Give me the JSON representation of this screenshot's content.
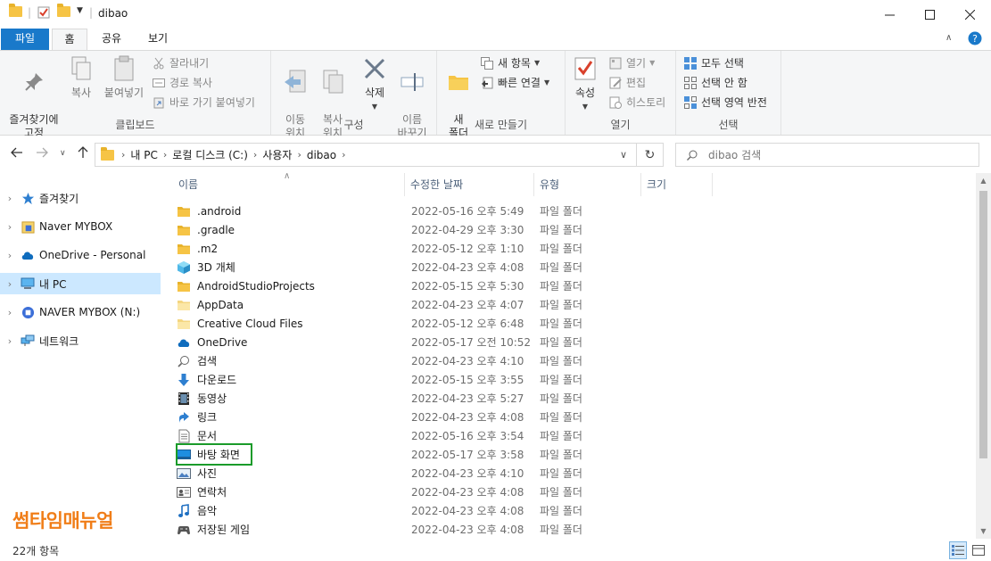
{
  "window": {
    "title": "dibao",
    "minimize": "—",
    "maximize": "☐",
    "close": "✕"
  },
  "tabs": [
    {
      "label": "파일"
    },
    {
      "label": "홈"
    },
    {
      "label": "공유"
    },
    {
      "label": "보기"
    }
  ],
  "ribbon": {
    "clipboard": {
      "label": "클립보드",
      "pin": "즐겨찾기에\n고정",
      "copy": "복사",
      "paste": "붙여넣기",
      "cut": "잘라내기",
      "copy_path": "경로 복사",
      "paste_shortcut": "바로 가기 붙여넣기"
    },
    "organize": {
      "label": "구성",
      "move_to": "이동\n위치",
      "copy_to": "복사\n위치",
      "delete": "삭제",
      "rename": "이름\n바꾸기"
    },
    "new": {
      "label": "새로 만들기",
      "new_folder": "새\n폴더",
      "new_item": "새 항목",
      "easy_access": "빠른 연결"
    },
    "open": {
      "label": "열기",
      "properties": "속성",
      "open": "열기",
      "edit": "편집",
      "history": "히스토리"
    },
    "select": {
      "label": "선택",
      "select_all": "모두 선택",
      "select_none": "선택 안 함",
      "invert": "선택 영역 반전"
    }
  },
  "address": {
    "crumbs": [
      "내 PC",
      "로컬 디스크 (C:)",
      "사용자",
      "dibao"
    ],
    "search_placeholder": "dibao 검색"
  },
  "nav": [
    {
      "label": "즐겨찾기",
      "icon": "star-icon"
    },
    {
      "label": "Naver MYBOX",
      "icon": "mybox-icon"
    },
    {
      "label": "OneDrive - Personal",
      "icon": "cloud-icon"
    },
    {
      "label": "내 PC",
      "icon": "computer-icon",
      "selected": true
    },
    {
      "label": "NAVER MYBOX (N:)",
      "icon": "drive-icon"
    },
    {
      "label": "네트워크",
      "icon": "network-icon"
    }
  ],
  "columns": {
    "name": "이름",
    "date": "수정한 날짜",
    "type": "유형",
    "size": "크기"
  },
  "files": [
    {
      "name": ".android",
      "date": "2022-05-16 오후 5:49",
      "type": "파일 폴더",
      "icon": "folder"
    },
    {
      "name": ".gradle",
      "date": "2022-04-29 오후 3:30",
      "type": "파일 폴더",
      "icon": "folder"
    },
    {
      "name": ".m2",
      "date": "2022-05-12 오후 1:10",
      "type": "파일 폴더",
      "icon": "folder"
    },
    {
      "name": "3D 개체",
      "date": "2022-04-23 오후 4:08",
      "type": "파일 폴더",
      "icon": "3d"
    },
    {
      "name": "AndroidStudioProjects",
      "date": "2022-05-15 오후 5:30",
      "type": "파일 폴더",
      "icon": "folder"
    },
    {
      "name": "AppData",
      "date": "2022-04-23 오후 4:07",
      "type": "파일 폴더",
      "icon": "folder-pale"
    },
    {
      "name": "Creative Cloud Files",
      "date": "2022-05-12 오후 6:48",
      "type": "파일 폴더",
      "icon": "folder-pale"
    },
    {
      "name": "OneDrive",
      "date": "2022-05-17 오전 10:52",
      "type": "파일 폴더",
      "icon": "cloud"
    },
    {
      "name": "검색",
      "date": "2022-04-23 오후 4:10",
      "type": "파일 폴더",
      "icon": "search"
    },
    {
      "name": "다운로드",
      "date": "2022-05-15 오후 3:55",
      "type": "파일 폴더",
      "icon": "download"
    },
    {
      "name": "동영상",
      "date": "2022-04-23 오후 5:27",
      "type": "파일 폴더",
      "icon": "video"
    },
    {
      "name": "링크",
      "date": "2022-04-23 오후 4:08",
      "type": "파일 폴더",
      "icon": "link"
    },
    {
      "name": "문서",
      "date": "2022-05-16 오후 3:54",
      "type": "파일 폴더",
      "icon": "document"
    },
    {
      "name": "바탕 화면",
      "date": "2022-05-17 오후 3:58",
      "type": "파일 폴더",
      "icon": "desktop"
    },
    {
      "name": "사진",
      "date": "2022-04-23 오후 4:10",
      "type": "파일 폴더",
      "icon": "picture"
    },
    {
      "name": "연락처",
      "date": "2022-04-23 오후 4:08",
      "type": "파일 폴더",
      "icon": "contact"
    },
    {
      "name": "음악",
      "date": "2022-04-23 오후 4:08",
      "type": "파일 폴더",
      "icon": "music"
    },
    {
      "name": "저장된 게임",
      "date": "2022-04-23 오후 4:08",
      "type": "파일 폴더",
      "icon": "game"
    }
  ],
  "status": {
    "item_count": "22개 항목"
  },
  "watermark": "썸타임매뉴얼",
  "colors": {
    "accent": "#1979ca",
    "selection": "#cce8ff",
    "highlight_box": "#1a9b2a",
    "watermark": "#f07d17"
  }
}
